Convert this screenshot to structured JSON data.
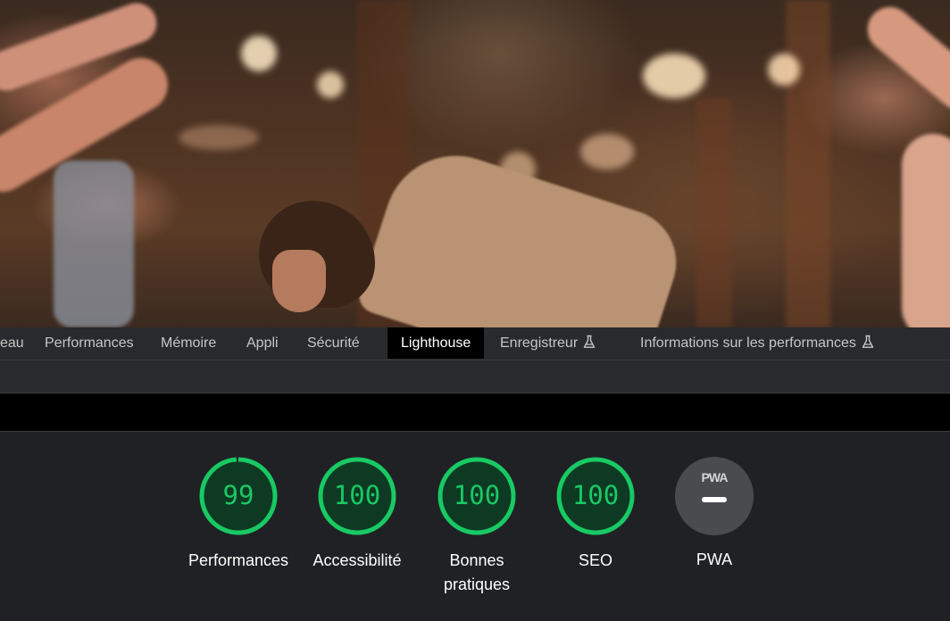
{
  "devtools": {
    "tabs": [
      {
        "label": "eau",
        "active": false,
        "experimental": false
      },
      {
        "label": "Performances",
        "active": false,
        "experimental": false
      },
      {
        "label": "Mémoire",
        "active": false,
        "experimental": false
      },
      {
        "label": "Appli",
        "active": false,
        "experimental": false
      },
      {
        "label": "Sécurité",
        "active": false,
        "experimental": false
      },
      {
        "label": "Lighthouse",
        "active": true,
        "experimental": false
      },
      {
        "label": "Enregistreur",
        "active": false,
        "experimental": true,
        "icon": "flask-icon"
      },
      {
        "label": "Informations sur les performances",
        "active": false,
        "experimental": true,
        "icon": "flask-icon"
      }
    ]
  },
  "lighthouse": {
    "scores": [
      {
        "label": "Performances",
        "score": "99",
        "value": 99
      },
      {
        "label": "Accessibilité",
        "score": "100",
        "value": 100
      },
      {
        "label": "Bonnes pratiques",
        "score": "100",
        "value": 100
      },
      {
        "label": "SEO",
        "score": "100",
        "value": 100
      }
    ],
    "pwa": {
      "badge": "PWA",
      "label": "PWA",
      "icon": "pwa-dash-icon"
    },
    "colors": {
      "pass": "#18c964",
      "pass_bg": "#0e3a23",
      "pwa_bg": "#4a4b4e"
    }
  }
}
